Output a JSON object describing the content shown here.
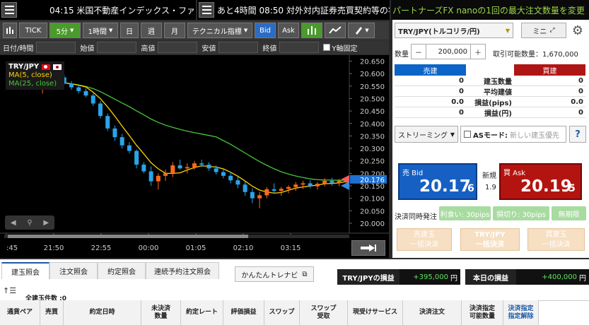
{
  "tickers": {
    "left": "04:15 米国不動産インデックス・ファ",
    "mid": "あと4時間 08:50 対外対内証券売買契約等の状",
    "right": "パートナーズFX nanoの1回の最大注文数量を変更"
  },
  "toolbar": {
    "tick": "TICK",
    "interval": "5分",
    "period": "1時間",
    "day": "日",
    "week": "週",
    "month": "月",
    "tech": "テクニカル指標",
    "bid": "Bid",
    "ask": "Ask"
  },
  "ohlc": {
    "datetime": "日付/時間",
    "open": "始値",
    "high": "高値",
    "low": "安値",
    "close": "終値",
    "yfix": "Y軸固定"
  },
  "legend": {
    "pair": "TRY/JPY",
    "ma5": "MA(5, close)",
    "ma25": "MA(25, close)"
  },
  "chart_data": {
    "type": "candlestick",
    "x_ticks": [
      ":45",
      "21:50",
      "22:55",
      "00:00",
      "01:05",
      "02:10",
      "03:15"
    ],
    "y_ticks": [
      "20.650",
      "20.600",
      "20.550",
      "20.500",
      "20.450",
      "20.400",
      "20.350",
      "20.300",
      "20.250",
      "20.200",
      "20.150",
      "20.100",
      "20.050",
      "20.000"
    ],
    "ylim": [
      19.98,
      20.66
    ],
    "current_price": "20.176",
    "colors": {
      "up": "#ff6a1a",
      "down": "#2aa4e8",
      "ma5": "#ffd400",
      "ma25": "#49c23b"
    },
    "candles": [
      [
        20.54,
        20.565,
        20.52,
        20.558
      ],
      [
        20.558,
        20.575,
        20.54,
        20.548
      ],
      [
        20.548,
        20.6,
        20.545,
        20.585
      ],
      [
        20.585,
        20.595,
        20.555,
        20.56
      ],
      [
        20.56,
        20.57,
        20.535,
        20.545
      ],
      [
        20.545,
        20.555,
        20.52,
        20.53
      ],
      [
        20.53,
        20.54,
        20.505,
        20.512
      ],
      [
        20.512,
        20.52,
        20.47,
        20.48
      ],
      [
        20.48,
        20.49,
        20.42,
        20.43
      ],
      [
        20.43,
        20.44,
        20.37,
        20.38
      ],
      [
        20.38,
        20.392,
        20.33,
        20.345
      ],
      [
        20.345,
        20.358,
        20.3,
        20.312
      ],
      [
        20.312,
        20.325,
        20.28,
        20.29
      ],
      [
        20.29,
        20.296,
        20.22,
        20.235
      ],
      [
        20.235,
        20.245,
        20.2,
        20.208
      ],
      [
        20.208,
        20.228,
        20.15,
        20.168
      ],
      [
        20.168,
        20.2,
        20.135,
        20.19
      ],
      [
        20.19,
        20.215,
        20.17,
        20.2
      ],
      [
        20.2,
        20.245,
        20.185,
        20.232
      ],
      [
        20.232,
        20.255,
        20.215,
        20.22
      ],
      [
        20.22,
        20.24,
        20.2,
        20.225
      ],
      [
        20.225,
        20.25,
        20.215,
        20.24
      ],
      [
        20.24,
        20.255,
        20.225,
        20.235
      ],
      [
        20.235,
        20.245,
        20.21,
        20.22
      ],
      [
        20.22,
        20.232,
        20.195,
        20.205
      ],
      [
        20.205,
        20.218,
        20.18,
        20.19
      ],
      [
        20.19,
        20.205,
        20.16,
        20.172
      ],
      [
        20.172,
        20.188,
        20.14,
        20.155
      ],
      [
        20.155,
        20.168,
        20.11,
        20.125
      ],
      [
        20.125,
        20.14,
        20.08,
        20.1
      ],
      [
        20.1,
        20.125,
        20.06,
        20.112
      ],
      [
        20.112,
        20.145,
        20.1,
        20.136
      ],
      [
        20.136,
        20.16,
        20.118,
        20.13
      ],
      [
        20.13,
        20.146,
        20.11,
        20.138
      ],
      [
        20.138,
        20.152,
        20.12,
        20.145
      ],
      [
        20.145,
        20.165,
        20.13,
        20.155
      ],
      [
        20.155,
        20.17,
        20.138,
        20.16
      ],
      [
        20.16,
        20.172,
        20.14,
        20.148
      ],
      [
        20.148,
        20.165,
        20.135,
        20.158
      ],
      [
        20.158,
        20.18,
        20.148,
        20.17
      ],
      [
        20.17,
        20.182,
        20.15,
        20.162
      ],
      [
        20.162,
        20.178,
        20.148,
        20.17
      ],
      [
        20.17,
        20.185,
        20.158,
        20.176
      ]
    ]
  },
  "rp": {
    "pair": "TRY/JPY(トルコリラ/円)",
    "mini": "ミニ",
    "qty_label": "数量",
    "minus": "－",
    "qty": "200,000",
    "plus": "＋",
    "avail": "取引可能数量：1,670,000",
    "sell_head": "売建",
    "buy_head": "買建",
    "rows": [
      {
        "label": "建玉数量",
        "sell": "0",
        "buy": "0"
      },
      {
        "label": "平均建値",
        "sell": "0",
        "buy": "0"
      },
      {
        "label": "損益(pips)",
        "sell": "0.0",
        "buy": "0.0"
      },
      {
        "label": "損益(円)",
        "sell": "0",
        "buy": "0"
      }
    ],
    "streaming": "ストリーミング",
    "as_mode": "ASモード:",
    "as_hint": "新しい建玉優先",
    "help": "?",
    "bid_label": "売 Bid",
    "bid_big": "20.17",
    "bid_small": "6",
    "spread_label": "新規",
    "spread": "1.9",
    "ask_label": "買 Ask",
    "ask_big": "20.19",
    "ask_small": "5",
    "settle_label": "決済同時発注",
    "tp": "利食い: 30pips",
    "sl": "損切り: 30pips",
    "nolimit": "無期限",
    "b1a": "売建玉",
    "b1b": "一括決済",
    "b2a": "TRY/JPY",
    "b2b": "一括決済",
    "b3a": "買建玉",
    "b3b": "一括決済"
  },
  "bottom": {
    "tabs": [
      "建玉照会",
      "注文照会",
      "約定照会",
      "連続予約注文照会"
    ],
    "trenavi": "かんたんトレナビ",
    "pl_label": "TRY/JPYの損益",
    "pl_value": "+395,000",
    "pl_unit": "円",
    "today_label": "本日の損益",
    "today_value": "+400,000",
    "today_unit": "円",
    "count": "全建玉件数 :0",
    "cols": [
      "通貨ペア",
      "売買",
      "約定日時",
      "未決済\n数量",
      "約定レート",
      "評価損益",
      "スワップ",
      "スワップ\n受取",
      "現受けサービス",
      "決済注文",
      "決済指定\n可能数量",
      "決済指定\n指定解除"
    ]
  }
}
